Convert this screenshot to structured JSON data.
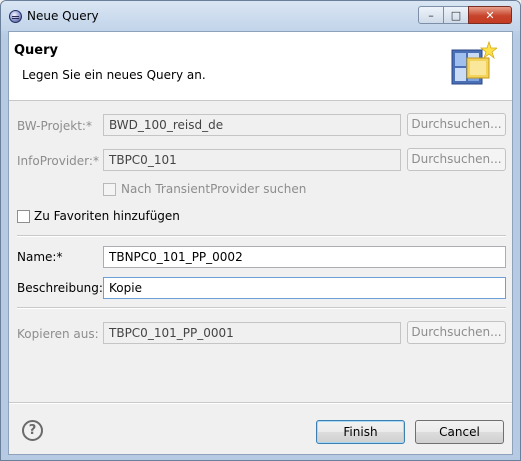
{
  "window": {
    "title": "Neue Query"
  },
  "header": {
    "title": "Query",
    "description": "Legen Sie ein neues Query an."
  },
  "form": {
    "bw_project": {
      "label": "BW-Projekt:*",
      "value": "BWD_100_reisd_de",
      "browse_label": "Durchsuchen..."
    },
    "infoprovider": {
      "label": "InfoProvider:*",
      "value": "TBPC0_101",
      "browse_label": "Durchsuchen..."
    },
    "transient_provider": {
      "label": "Nach TransientProvider suchen",
      "checked": false
    },
    "favorites": {
      "label": "Zu Favoriten hinzufügen",
      "checked": false
    },
    "name": {
      "label": "Name:*",
      "value": "TBNPC0_101_PP_0002"
    },
    "description": {
      "label": "Beschreibung:",
      "value": "Kopie"
    },
    "copy_from": {
      "label": "Kopieren aus:",
      "value": "TBPC0_101_PP_0001",
      "browse_label": "Durchsuchen..."
    }
  },
  "footer": {
    "finish_label": "Finish",
    "cancel_label": "Cancel"
  }
}
